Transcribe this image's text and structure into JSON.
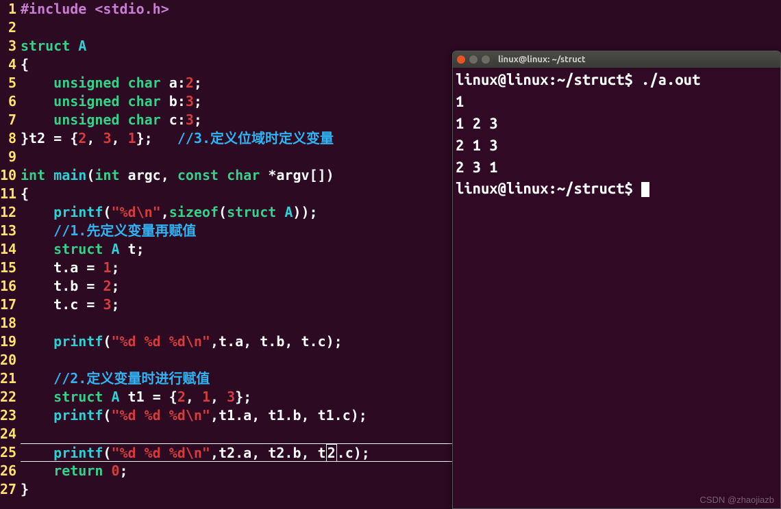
{
  "editor": {
    "lines": [
      {
        "n": 1,
        "tokens": [
          [
            "pp",
            "#include "
          ],
          [
            "pp",
            "<stdio.h>"
          ]
        ]
      },
      {
        "n": 2,
        "tokens": []
      },
      {
        "n": 3,
        "tokens": [
          [
            "kw",
            "struct"
          ],
          [
            "id",
            " "
          ],
          [
            "ty",
            "A"
          ]
        ]
      },
      {
        "n": 4,
        "tokens": [
          [
            "pn",
            "{"
          ]
        ]
      },
      {
        "n": 5,
        "tokens": [
          [
            "id",
            "    "
          ],
          [
            "kw",
            "unsigned"
          ],
          [
            "id",
            " "
          ],
          [
            "kw",
            "char"
          ],
          [
            "id",
            " a"
          ],
          [
            "pn",
            ":"
          ],
          [
            "num",
            "2"
          ],
          [
            "pn",
            ";"
          ]
        ]
      },
      {
        "n": 6,
        "tokens": [
          [
            "id",
            "    "
          ],
          [
            "kw",
            "unsigned"
          ],
          [
            "id",
            " "
          ],
          [
            "kw",
            "char"
          ],
          [
            "id",
            " b"
          ],
          [
            "pn",
            ":"
          ],
          [
            "num",
            "3"
          ],
          [
            "pn",
            ";"
          ]
        ]
      },
      {
        "n": 7,
        "tokens": [
          [
            "id",
            "    "
          ],
          [
            "kw",
            "unsigned"
          ],
          [
            "id",
            " "
          ],
          [
            "kw",
            "char"
          ],
          [
            "id",
            " c"
          ],
          [
            "pn",
            ":"
          ],
          [
            "num",
            "3"
          ],
          [
            "pn",
            ";"
          ]
        ]
      },
      {
        "n": 8,
        "tokens": [
          [
            "pn",
            "}"
          ],
          [
            "id",
            "t2 "
          ],
          [
            "pn",
            "= {"
          ],
          [
            "num",
            "2"
          ],
          [
            "pn",
            ", "
          ],
          [
            "num",
            "3"
          ],
          [
            "pn",
            ", "
          ],
          [
            "num",
            "1"
          ],
          [
            "pn",
            "};   "
          ],
          [
            "cm",
            "//3.定义位域时定义变量"
          ]
        ]
      },
      {
        "n": 9,
        "tokens": []
      },
      {
        "n": 10,
        "tokens": [
          [
            "kw",
            "int"
          ],
          [
            "id",
            " "
          ],
          [
            "fn",
            "main"
          ],
          [
            "pn",
            "("
          ],
          [
            "kw",
            "int"
          ],
          [
            "id",
            " argc"
          ],
          [
            "pn",
            ", "
          ],
          [
            "kw",
            "const"
          ],
          [
            "id",
            " "
          ],
          [
            "kw",
            "char"
          ],
          [
            "id",
            " "
          ],
          [
            "pn",
            "*"
          ],
          [
            "id",
            "argv"
          ],
          [
            "pn",
            "[]"
          ],
          [
            "pn",
            ")"
          ]
        ]
      },
      {
        "n": 11,
        "tokens": [
          [
            "pn",
            "{"
          ]
        ]
      },
      {
        "n": 12,
        "tokens": [
          [
            "id",
            "    "
          ],
          [
            "fn",
            "printf"
          ],
          [
            "pn",
            "("
          ],
          [
            "str",
            "\"%d\\n\""
          ],
          [
            "pn",
            ","
          ],
          [
            "kw",
            "sizeof"
          ],
          [
            "pn",
            "("
          ],
          [
            "kw",
            "struct"
          ],
          [
            "id",
            " "
          ],
          [
            "ty",
            "A"
          ],
          [
            "pn",
            "));"
          ]
        ]
      },
      {
        "n": 13,
        "tokens": [
          [
            "id",
            "    "
          ],
          [
            "cm",
            "//1.先定义变量再赋值"
          ]
        ]
      },
      {
        "n": 14,
        "tokens": [
          [
            "id",
            "    "
          ],
          [
            "kw",
            "struct"
          ],
          [
            "id",
            " "
          ],
          [
            "ty",
            "A"
          ],
          [
            "id",
            " t"
          ],
          [
            "pn",
            ";"
          ]
        ]
      },
      {
        "n": 15,
        "tokens": [
          [
            "id",
            "    t"
          ],
          [
            "pn",
            "."
          ],
          [
            "id",
            "a "
          ],
          [
            "pn",
            "= "
          ],
          [
            "num",
            "1"
          ],
          [
            "pn",
            ";"
          ]
        ]
      },
      {
        "n": 16,
        "tokens": [
          [
            "id",
            "    t"
          ],
          [
            "pn",
            "."
          ],
          [
            "id",
            "b "
          ],
          [
            "pn",
            "= "
          ],
          [
            "num",
            "2"
          ],
          [
            "pn",
            ";"
          ]
        ]
      },
      {
        "n": 17,
        "tokens": [
          [
            "id",
            "    t"
          ],
          [
            "pn",
            "."
          ],
          [
            "id",
            "c "
          ],
          [
            "pn",
            "= "
          ],
          [
            "num",
            "3"
          ],
          [
            "pn",
            ";"
          ]
        ]
      },
      {
        "n": 18,
        "tokens": []
      },
      {
        "n": 19,
        "tokens": [
          [
            "id",
            "    "
          ],
          [
            "fn",
            "printf"
          ],
          [
            "pn",
            "("
          ],
          [
            "str",
            "\"%d %d %d\\n\""
          ],
          [
            "pn",
            ","
          ],
          [
            "id",
            "t"
          ],
          [
            "pn",
            "."
          ],
          [
            "id",
            "a"
          ],
          [
            "pn",
            ", "
          ],
          [
            "id",
            "t"
          ],
          [
            "pn",
            "."
          ],
          [
            "id",
            "b"
          ],
          [
            "pn",
            ", "
          ],
          [
            "id",
            "t"
          ],
          [
            "pn",
            "."
          ],
          [
            "id",
            "c"
          ],
          [
            "pn",
            ");"
          ]
        ]
      },
      {
        "n": 20,
        "tokens": []
      },
      {
        "n": 21,
        "tokens": [
          [
            "id",
            "    "
          ],
          [
            "cm",
            "//2.定义变量时进行赋值"
          ]
        ]
      },
      {
        "n": 22,
        "tokens": [
          [
            "id",
            "    "
          ],
          [
            "kw",
            "struct"
          ],
          [
            "id",
            " "
          ],
          [
            "ty",
            "A"
          ],
          [
            "id",
            " t1 "
          ],
          [
            "pn",
            "= {"
          ],
          [
            "num",
            "2"
          ],
          [
            "pn",
            ", "
          ],
          [
            "num",
            "1"
          ],
          [
            "pn",
            ", "
          ],
          [
            "num",
            "3"
          ],
          [
            "pn",
            "};"
          ]
        ]
      },
      {
        "n": 23,
        "tokens": [
          [
            "id",
            "    "
          ],
          [
            "fn",
            "printf"
          ],
          [
            "pn",
            "("
          ],
          [
            "str",
            "\"%d %d %d\\n\""
          ],
          [
            "pn",
            ","
          ],
          [
            "id",
            "t1"
          ],
          [
            "pn",
            "."
          ],
          [
            "id",
            "a"
          ],
          [
            "pn",
            ", "
          ],
          [
            "id",
            "t1"
          ],
          [
            "pn",
            "."
          ],
          [
            "id",
            "b"
          ],
          [
            "pn",
            ", "
          ],
          [
            "id",
            "t1"
          ],
          [
            "pn",
            "."
          ],
          [
            "id",
            "c"
          ],
          [
            "pn",
            ");"
          ]
        ]
      },
      {
        "n": 24,
        "tokens": []
      },
      {
        "n": 25,
        "hl": true,
        "tokens": [
          [
            "id",
            "    "
          ],
          [
            "fn",
            "printf"
          ],
          [
            "pn",
            "("
          ],
          [
            "str",
            "\"%d %d %d\\n\""
          ],
          [
            "pn",
            ","
          ],
          [
            "id",
            "t2"
          ],
          [
            "pn",
            "."
          ],
          [
            "id",
            "a"
          ],
          [
            "pn",
            ", "
          ],
          [
            "id",
            "t2"
          ],
          [
            "pn",
            "."
          ],
          [
            "id",
            "b"
          ],
          [
            "pn",
            ", "
          ],
          [
            "id",
            "t"
          ],
          [
            "cursor",
            "2"
          ],
          [
            "pn",
            "."
          ],
          [
            "id",
            "c"
          ],
          [
            "pn",
            ");"
          ]
        ]
      },
      {
        "n": 26,
        "tokens": [
          [
            "id",
            "    "
          ],
          [
            "kw",
            "return"
          ],
          [
            "id",
            " "
          ],
          [
            "num",
            "0"
          ],
          [
            "pn",
            ";"
          ]
        ]
      },
      {
        "n": 27,
        "tokens": [
          [
            "pn",
            "}"
          ]
        ]
      }
    ]
  },
  "terminal": {
    "title": "linux@linux: ~/struct",
    "prompt_prefix": "linux@linux:~/struct$ ",
    "command": "./a.out",
    "output": [
      "1",
      "1 2 3",
      "2 1 3",
      "2 3 1"
    ],
    "prompt_after": "linux@linux:~/struct$ "
  },
  "watermark": "CSDN @zhaojiazb"
}
